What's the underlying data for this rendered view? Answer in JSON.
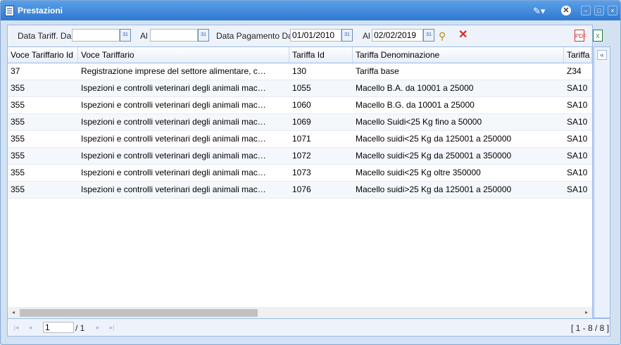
{
  "window": {
    "title": "Prestazioni"
  },
  "filters": {
    "data_tariff_dal_label": "Data Tariff. Dal",
    "data_tariff_dal_value": "",
    "al1_label": "Al",
    "al1_value": "",
    "data_pagamento_dal_label": "Data Pagamento Dal",
    "data_pagamento_dal_value": "01/01/2010",
    "al2_label": "Al",
    "al2_value": "02/02/2019"
  },
  "grid": {
    "columns": [
      "Voce Tariffario Id",
      "Voce Tariffario",
      "Tariffa Id",
      "Tariffa Denominazione",
      "Tariffa"
    ],
    "rows": [
      [
        "37",
        "Registrazione imprese del settore alimentare, c…",
        "130",
        "Tariffa base",
        "Z34"
      ],
      [
        "355",
        "Ispezioni e controlli veterinari degli animali mac…",
        "1055",
        "Macello B.A. da 10001 a 25000",
        "SA10"
      ],
      [
        "355",
        "Ispezioni e controlli veterinari degli animali mac…",
        "1060",
        "Macello B.G. da 10001 a 25000",
        "SA10"
      ],
      [
        "355",
        "Ispezioni e controlli veterinari degli animali mac…",
        "1069",
        "Macello Suidi<25 Kg fino a 50000",
        "SA10"
      ],
      [
        "355",
        "Ispezioni e controlli veterinari degli animali mac…",
        "1071",
        "Macello suidi<25 Kg da 125001 a 250000",
        "SA10"
      ],
      [
        "355",
        "Ispezioni e controlli veterinari degli animali mac…",
        "1072",
        "Macello suidi<25 Kg da 250001 a 350000",
        "SA10"
      ],
      [
        "355",
        "Ispezioni e controlli veterinari degli animali mac…",
        "1073",
        "Macello suidi<25 Kg oltre 350000",
        "SA10"
      ],
      [
        "355",
        "Ispezioni e controlli veterinari degli animali mac…",
        "1076",
        "Macello suidi>25 Kg da 125001 a 250000",
        "SA10"
      ]
    ]
  },
  "pager": {
    "page_value": "1",
    "page_total": "/ 1",
    "range": "[ 1 - 8 / 8 ]"
  },
  "icons": {
    "calendar": "calendar-icon",
    "search": "search-icon",
    "clear": "clear-filter-icon",
    "pdf": "pdf-export-icon",
    "excel": "excel-export-icon",
    "collapse": "double-chevron-left-icon"
  },
  "colors": {
    "title_bar": "#3b84d9",
    "grid_border": "#99bbe8",
    "clear_red": "#e0251d"
  }
}
